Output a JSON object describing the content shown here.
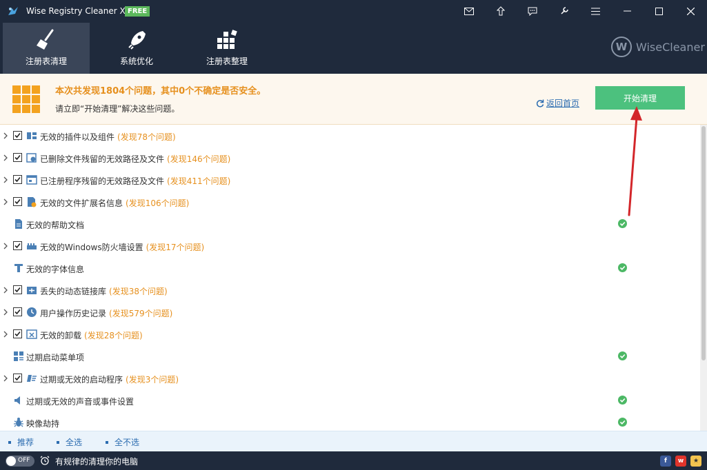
{
  "app": {
    "title": "Wise Registry Cleaner X",
    "badge": "FREE"
  },
  "nav": [
    {
      "label": "注册表清理",
      "active": true
    },
    {
      "label": "系统优化",
      "active": false
    },
    {
      "label": "注册表整理",
      "active": false
    }
  ],
  "brand": {
    "mark": "W",
    "name": "WiseCleaner"
  },
  "notice": {
    "title": "本次共发现1804个问题，其中0个不确定是否安全。",
    "subtitle": "请立即“开始清理”解决这些问题。",
    "back_link": "返回首页",
    "start_button": "开始清理"
  },
  "items": [
    {
      "label": "无效的插件以及组件",
      "count": "(发现78个问题)",
      "checked": true,
      "icon": "plugin-icon"
    },
    {
      "label": "已删除文件残留的无效路径及文件",
      "count": "(发现146个问题)",
      "checked": true,
      "icon": "deleted-file-icon"
    },
    {
      "label": "已注册程序残留的无效路径及文件",
      "count": "(发现411个问题)",
      "checked": true,
      "icon": "program-window-icon"
    },
    {
      "label": "无效的文件扩展名信息",
      "count": "(发现106个问题)",
      "checked": true,
      "icon": "file-extension-icon"
    },
    {
      "label": "无效的帮助文档",
      "count": "",
      "checked": false,
      "icon": "help-doc-icon"
    },
    {
      "label": "无效的Windows防火墙设置",
      "count": "(发现17个问题)",
      "checked": true,
      "icon": "firewall-icon"
    },
    {
      "label": "无效的字体信息",
      "count": "",
      "checked": false,
      "icon": "font-icon"
    },
    {
      "label": "丢失的动态链接库",
      "count": "(发现38个问题)",
      "checked": true,
      "icon": "dll-icon"
    },
    {
      "label": "用户操作历史记录",
      "count": "(发现579个问题)",
      "checked": true,
      "icon": "history-clock-icon"
    },
    {
      "label": "无效的卸载",
      "count": "(发现28个问题)",
      "checked": true,
      "icon": "uninstall-icon"
    },
    {
      "label": "过期启动菜单项",
      "count": "",
      "checked": false,
      "icon": "start-menu-icon"
    },
    {
      "label": "过期或无效的启动程序",
      "count": "(发现3个问题)",
      "checked": true,
      "icon": "startup-program-icon"
    },
    {
      "label": "过期或无效的声音或事件设置",
      "count": "",
      "checked": false,
      "icon": "sound-icon"
    },
    {
      "label": "映像劫持",
      "count": "",
      "checked": false,
      "icon": "image-hijack-bug-icon"
    }
  ],
  "selection": {
    "recommend": "推荐",
    "select_all": "全选",
    "select_none": "全不选"
  },
  "status": {
    "toggle_label": "OFF",
    "text": "有规律的清理你的电脑"
  },
  "colors": {
    "dark": "#1f2a3c",
    "accent_orange": "#e6901e",
    "green": "#4cc17e",
    "link": "#2b6cb0"
  }
}
